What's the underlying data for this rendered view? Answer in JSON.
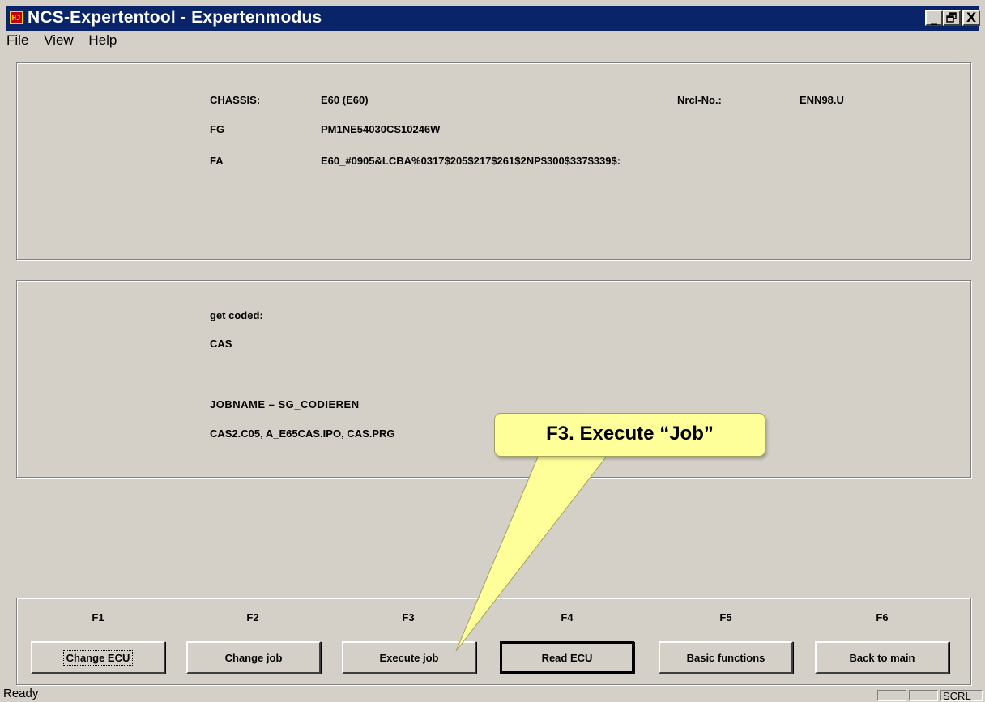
{
  "window": {
    "title": "NCS-Expertentool - Expertenmodus",
    "icon_label": "HJ",
    "minimize": "_",
    "restore": " ",
    "close": "X"
  },
  "menu": [
    "File",
    "View",
    "Help"
  ],
  "vehicle": {
    "chassis_label": "CHASSIS:",
    "chassis_value": "E60 (E60)",
    "nrcl_label": "Nrcl-No.:",
    "nrcl_value": "ENN98.U",
    "fg_label": "FG",
    "fg_value": "PM1NE54030CS10246W",
    "fa_label": "FA",
    "fa_value": "E60_#0905&LCBA%0317$205$217$261$2NP$300$337$339$:"
  },
  "coding": {
    "get_coded_label": "get coded:",
    "module": "CAS",
    "jobname": "JOBNAME – SG_CODIEREN",
    "files": "CAS2.C05, A_E65CAS.IPO, CAS.PRG"
  },
  "function_keys": [
    {
      "key": "F1",
      "label": "Change ECU"
    },
    {
      "key": "F2",
      "label": "Change job"
    },
    {
      "key": "F3",
      "label": "Execute job"
    },
    {
      "key": "F4",
      "label": "Read ECU"
    },
    {
      "key": "F5",
      "label": "Basic functions"
    },
    {
      "key": "F6",
      "label": "Back to main"
    }
  ],
  "callout": {
    "text": "F3. Execute “Job”",
    "color": "#ffff99"
  },
  "status": {
    "text": "Ready",
    "indicator": "SCRL"
  }
}
